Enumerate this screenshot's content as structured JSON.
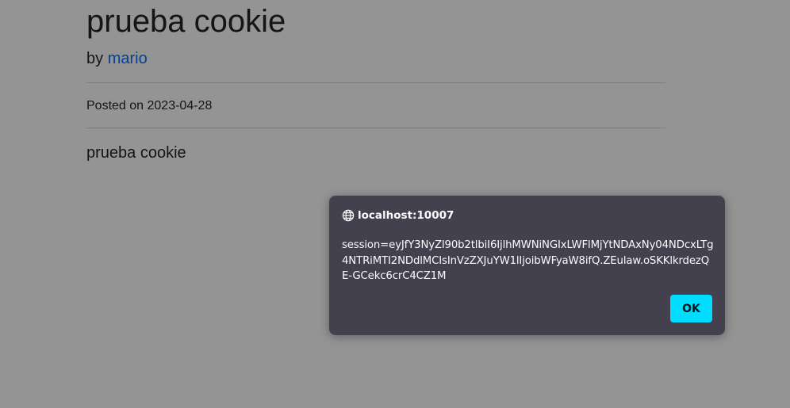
{
  "post": {
    "title": "prueba cookie",
    "byline_prefix": "by",
    "author": "mario",
    "posted_on": "Posted on 2023-04-28",
    "content": "prueba cookie"
  },
  "alert": {
    "icon": "globe-icon",
    "host": "localhost:10007",
    "message": "session=eyJfY3NyZl90b2tlbiI6IjlhMWNiNGIxLWFlMjYtNDAxNy04NDcxLTg4NTRiMTI2NDdlMCIsInVzZXJuYW1lIjoibWFyaW8ifQ.ZEulaw.oSKKlkrdezQE-GCekc6crC4CZ1M",
    "ok_label": "OK",
    "accent_color": "#00ddff",
    "background_color": "#42414d"
  }
}
